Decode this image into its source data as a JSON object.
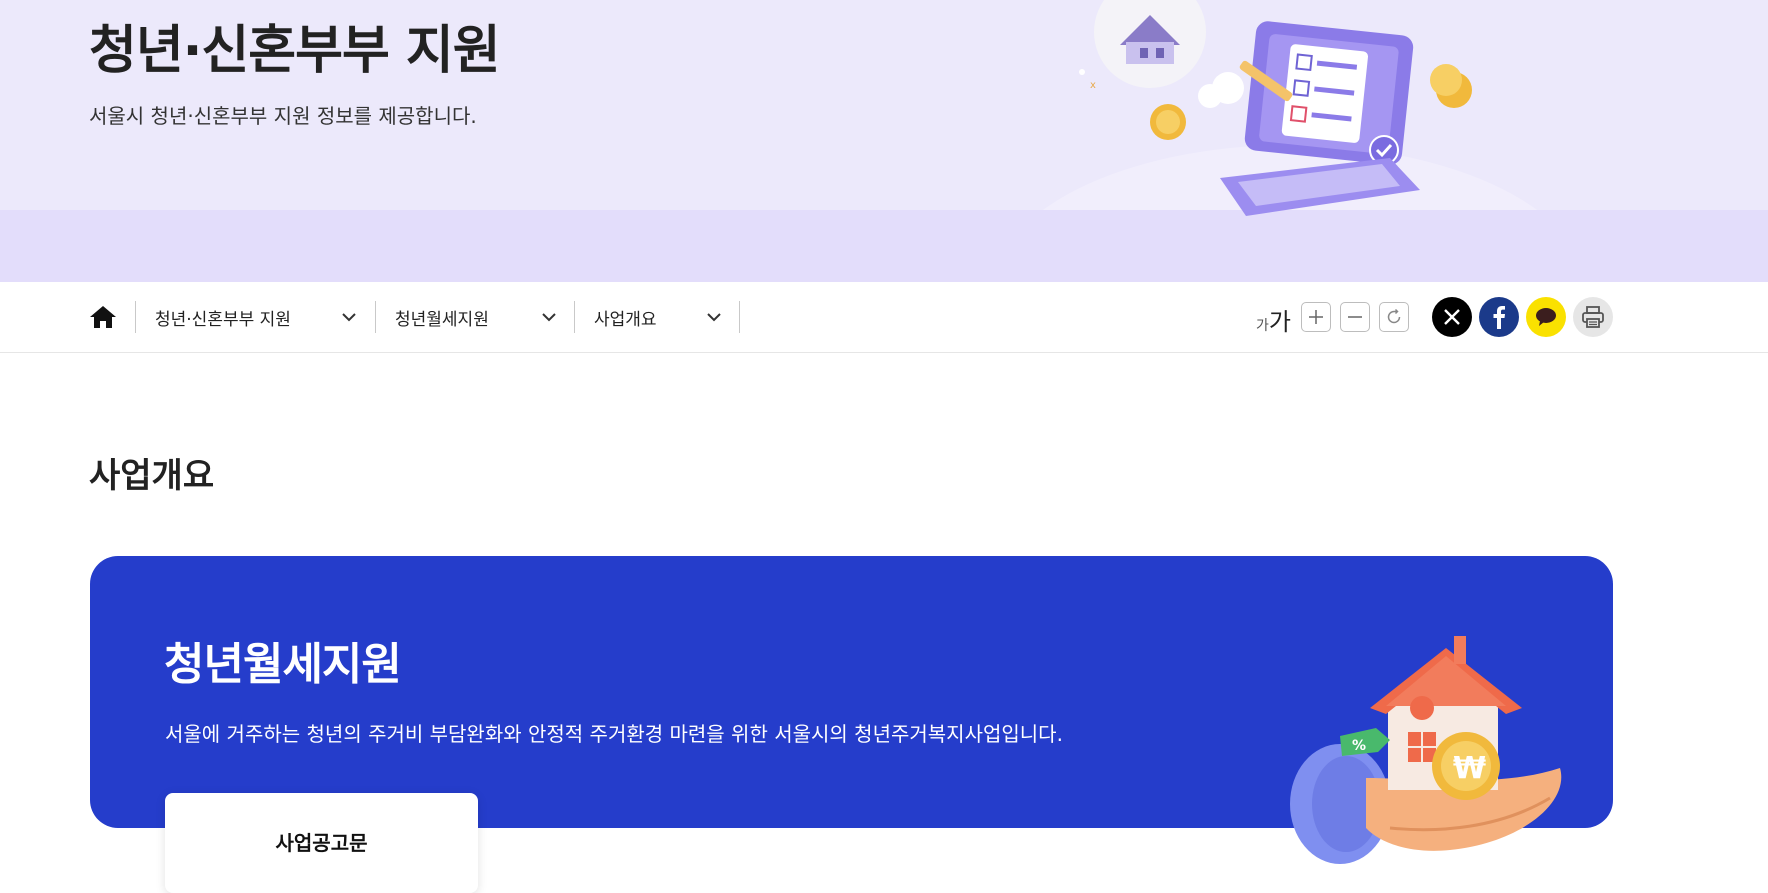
{
  "hero": {
    "title": "청년·신혼부부 지원",
    "subtitle": "서울시 청년·신혼부부 지원 정보를 제공합니다.",
    "illustration_icon": "laptop-checklist-illustration"
  },
  "nav": {
    "home_icon": "home-icon",
    "breadcrumbs": [
      {
        "label": "청년·신혼부부 지원"
      },
      {
        "label": "청년월세지원"
      },
      {
        "label": "사업개요"
      }
    ],
    "font_size": {
      "small_glyph": "가",
      "large_glyph": "가"
    },
    "tools": [
      "plus-icon",
      "minus-icon",
      "reset-icon"
    ],
    "share": [
      "x-icon",
      "facebook-icon",
      "kakaotalk-icon",
      "print-icon"
    ]
  },
  "main": {
    "page_title": "사업개요",
    "card": {
      "title": "청년월세지원",
      "description": "서울에 거주하는 청년의 주거비 부담완화와 안정적 주거환경 마련을 위한 서울시의 청년주거복지사업입니다.",
      "illustration_icon": "house-in-hand-illustration",
      "button_label": "사업공고문"
    }
  },
  "colors": {
    "hero_bg": "#ece9fb",
    "card_bg": "#253dcb",
    "kakao_yellow": "#fae100",
    "facebook_blue": "#1b3a8a",
    "x_black": "#000000"
  }
}
